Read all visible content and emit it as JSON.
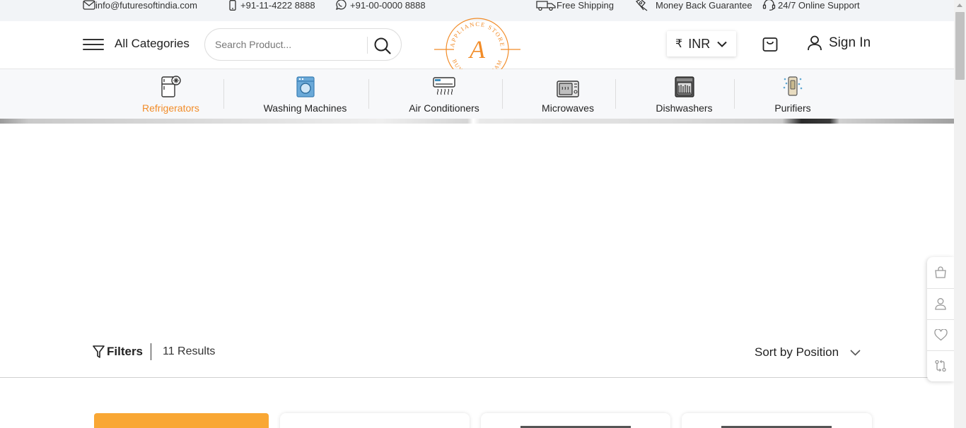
{
  "topbar": {
    "email": "info@futuresoftindia.com",
    "phone": "+91-11-4222 8888",
    "whatsapp": "+91-00-0000 8888",
    "shipping": "Free Shipping",
    "guarantee": "Money Back Guarantee",
    "support": "24/7 Online Support"
  },
  "header": {
    "categories_label": "All Categories",
    "search_placeholder": "Search Product...",
    "logo_top_text": "APPLIANCE STORE",
    "logo_letter": "A",
    "logo_bottom_text": "BUY YOUR DREAM",
    "currency_symbol": "₹",
    "currency": "INR",
    "signin_label": "Sign In"
  },
  "categories": [
    {
      "label": "Refrigerators",
      "icon": "refrigerator-icon",
      "active": true
    },
    {
      "label": "Washing Machines",
      "icon": "washing-machine-icon",
      "active": false
    },
    {
      "label": "Air Conditioners",
      "icon": "air-conditioner-icon",
      "active": false
    },
    {
      "label": "Microwaves",
      "icon": "microwave-icon",
      "active": false
    },
    {
      "label": "Dishwashers",
      "icon": "dishwasher-icon",
      "active": false
    },
    {
      "label": "Purifiers",
      "icon": "purifier-icon",
      "active": false
    }
  ],
  "toolbar": {
    "filters_label": "Filters",
    "results_label": "11 Results",
    "sort_label": "Sort by Position"
  },
  "sidebar": {
    "buttons": [
      "bag-icon",
      "user-icon",
      "heart-icon",
      "compare-icon"
    ]
  },
  "colors": {
    "accent": "#f28c28",
    "card_highlight": "#f9a734",
    "topbar_bg": "#f2f4f7"
  }
}
